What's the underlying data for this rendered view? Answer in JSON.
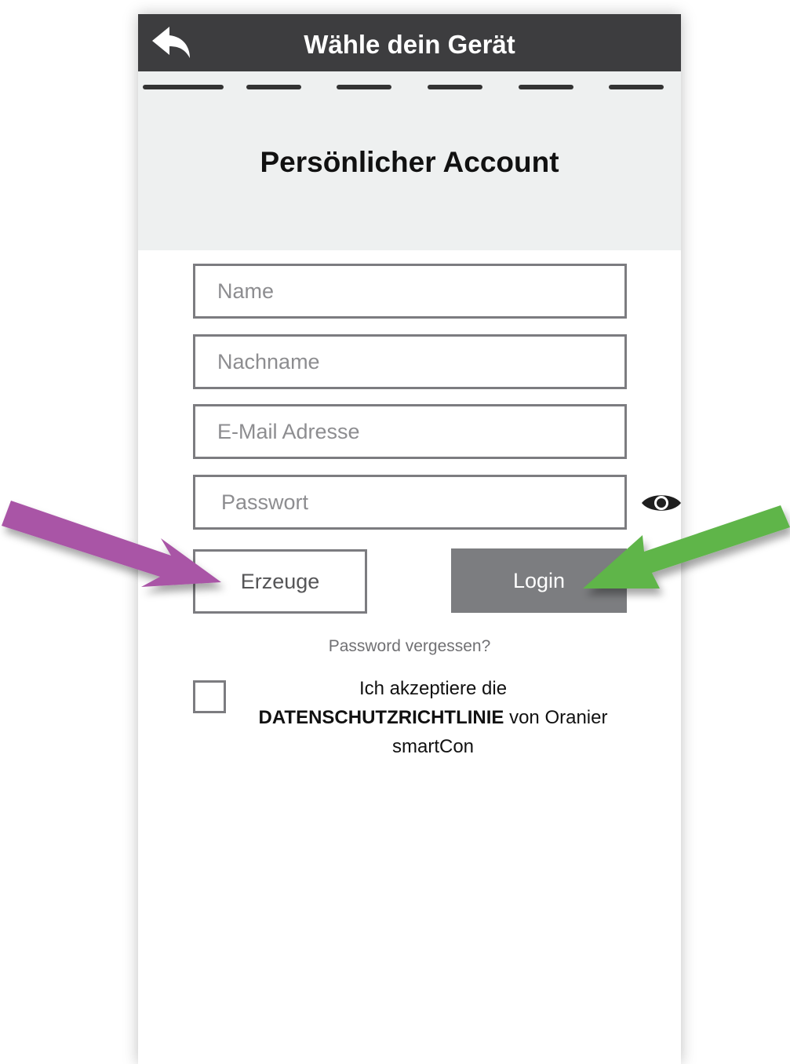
{
  "topbar": {
    "title": "Wähle dein Gerät",
    "back_icon": "back-arrow-icon"
  },
  "header": {
    "title": "Persönlicher Account",
    "steps_count": 6
  },
  "form": {
    "name_placeholder": "Name",
    "lastname_placeholder": "Nachname",
    "email_placeholder": "E-Mail Adresse",
    "password_placeholder": "Passwort",
    "eye_icon": "eye-icon"
  },
  "buttons": {
    "create_label": "Erzeuge",
    "login_label": "Login"
  },
  "forgot_password": "Password vergessen?",
  "privacy": {
    "prefix": "Ich akzeptiere die",
    "link": "DATENSCHUTZRICHTLINIE",
    "suffix": "von Oranier smartCon"
  },
  "colors": {
    "topbar": "#3d3d3f",
    "header_bg": "#eef0f0",
    "field_border": "#7c7c80",
    "login_button": "#7c7d80",
    "purple_arrow": "#a954a6",
    "green_arrow": "#5fb54a"
  }
}
